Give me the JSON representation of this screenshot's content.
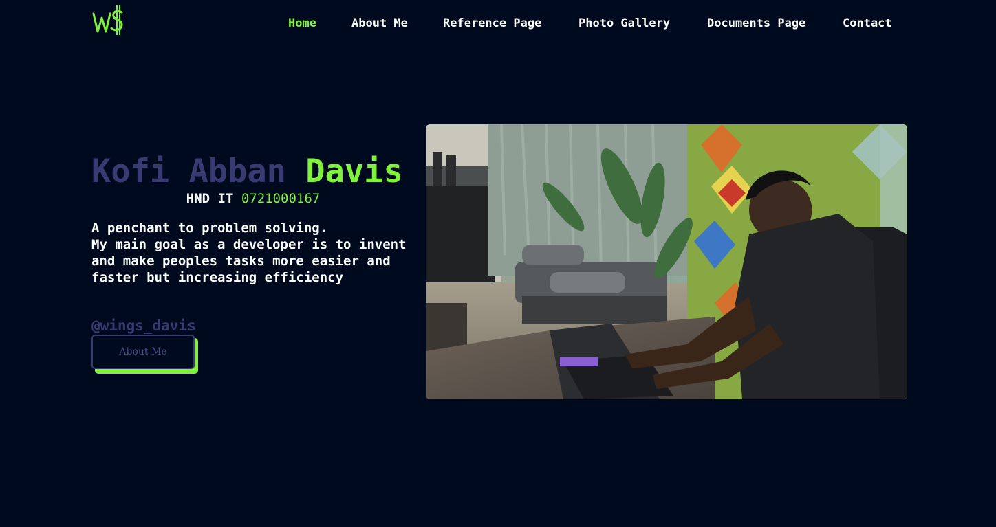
{
  "nav": {
    "logo_text": "W$",
    "links": [
      {
        "label": "Home",
        "active": true
      },
      {
        "label": "About Me",
        "active": false
      },
      {
        "label": "Reference Page",
        "active": false
      },
      {
        "label": "Photo Gallery",
        "active": false
      },
      {
        "label": "Documents Page",
        "active": false
      },
      {
        "label": "Contact",
        "active": false
      }
    ]
  },
  "hero": {
    "name_first": "Kofi Abban",
    "name_last": "Davis",
    "qualification": "HND IT",
    "phone": "0721000167",
    "bio": "A penchant to problem solving.\nMy main goal as a developer is to invent and make peoples tasks more easier and faster but increasing efficiency",
    "handle": "@wings_davis",
    "button_label": "About Me"
  },
  "colors": {
    "background": "#000a1f",
    "accent": "#7ff23b",
    "muted": "#3a3a72",
    "text": "#ffffff"
  }
}
